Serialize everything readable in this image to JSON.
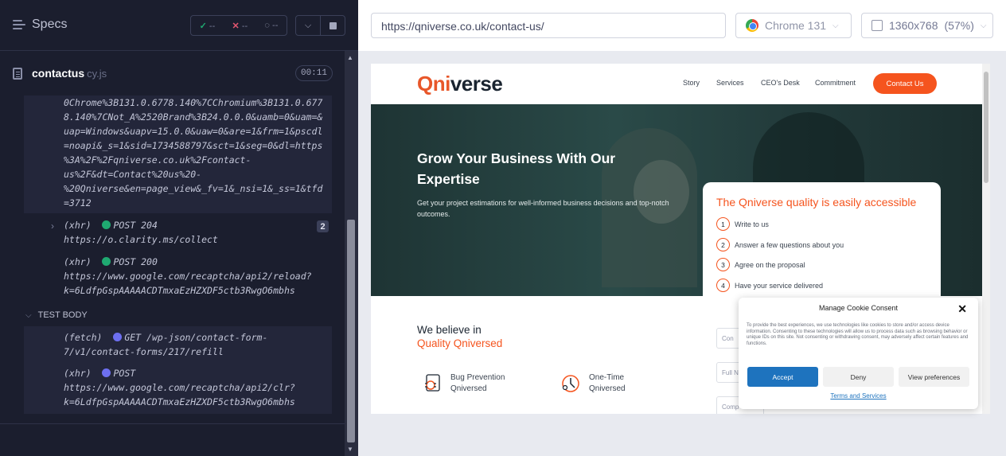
{
  "runner": {
    "specs_label": "Specs",
    "stats": {
      "passed": "--",
      "failed": "--",
      "pending": "--"
    },
    "file": {
      "name": "contactus",
      "ext": "cy.js",
      "timer": "00:11"
    },
    "logs": {
      "ga_url_lines": [
        "0Chrome%3B131.0.6778.140%7CChromium%3B131.0.677",
        "8.140%7CNot_A%2520Brand%3B24.0.0.0&uamb=0&uam=&",
        "uap=Windows&uapv=15.0.0&uaw=0&are=1&frm=1&pscdl",
        "=noapi&_s=1&sid=1734588797&sct=1&seg=0&dl=https",
        "%3A%2F%2Fqniverse.co.uk%2Fcontact-",
        "us%2F&dt=Contact%20us%20-",
        "%20Qniverse&en=page_view&_fv=1&_nsi=1&_ss=1&tfd",
        "=3712"
      ],
      "clarity": {
        "type": "(xhr)",
        "method": "POST 204",
        "url": "https://o.clarity.ms/collect",
        "count": "2"
      },
      "recaptcha_reload": {
        "type": "(xhr)",
        "method": "POST 200",
        "url_line1": "https://www.google.com/recaptcha/api2/reload?",
        "url_line2": "k=6LdfpGspAAAAACDTmxaEzHZXDF5ctb3RwgO6mbhs"
      },
      "test_body_label": "TEST BODY",
      "fetch": {
        "type": "(fetch)",
        "method": "GET",
        "url_line1": "/wp-json/contact-form-",
        "url_line2": "7/v1/contact-forms/217/refill"
      },
      "recaptcha_clr": {
        "type": "(xhr)",
        "method": "POST",
        "url_line1": "https://www.google.com/recaptcha/api2/clr?",
        "url_line2": "k=6LdfpGspAAAAACDTmxaEzHZXDF5ctb3RwgO6mbhs"
      }
    }
  },
  "browser": {
    "url": "https://qniverse.co.uk/contact-us/",
    "browser_name": "Chrome 131",
    "viewport": "1360x768",
    "zoom": "(57%)"
  },
  "site": {
    "logo_q": "Q",
    "logo_ni": "ni",
    "logo_verse": "verse",
    "nav": [
      "Story",
      "Services",
      "CEO's Desk",
      "Commitment"
    ],
    "cta": "Contact Us",
    "hero_title": "Grow Your Business With Our Expertise",
    "hero_sub": "Get your project estimations for well-informed business decisions and top-notch outcomes.",
    "card_title": "The Qniverse quality is easily accessible",
    "steps": [
      {
        "n": "1",
        "label": "Write to us"
      },
      {
        "n": "2",
        "label": "Answer a few questions about you"
      },
      {
        "n": "3",
        "label": "Agree on the proposal"
      },
      {
        "n": "4",
        "label": "Have your service delivered"
      }
    ],
    "fields": [
      "Con",
      "Full N",
      "Comp"
    ],
    "believe_line1": "We believe in",
    "believe_line2": "Quality Qniversed",
    "features": [
      {
        "l1": "Bug Prevention",
        "l2": "Qniversed"
      },
      {
        "l1": "One-Time",
        "l2": "Qniversed"
      }
    ]
  },
  "cookie": {
    "title": "Manage Cookie Consent",
    "text": "To provide the best experiences, we use technologies like cookies to store and/or access device information. Consenting to these technologies will allow us to process data such as browsing behavior or unique IDs on this site. Not consenting or withdrawing consent, may adversely affect certain features and functions.",
    "accept": "Accept",
    "deny": "Deny",
    "prefs": "View preferences",
    "link": "Terms and Services"
  },
  "colors": {
    "pass": "#1fa971",
    "fail": "#e45770",
    "brand": "#f5541e",
    "accept": "#1e73be"
  }
}
